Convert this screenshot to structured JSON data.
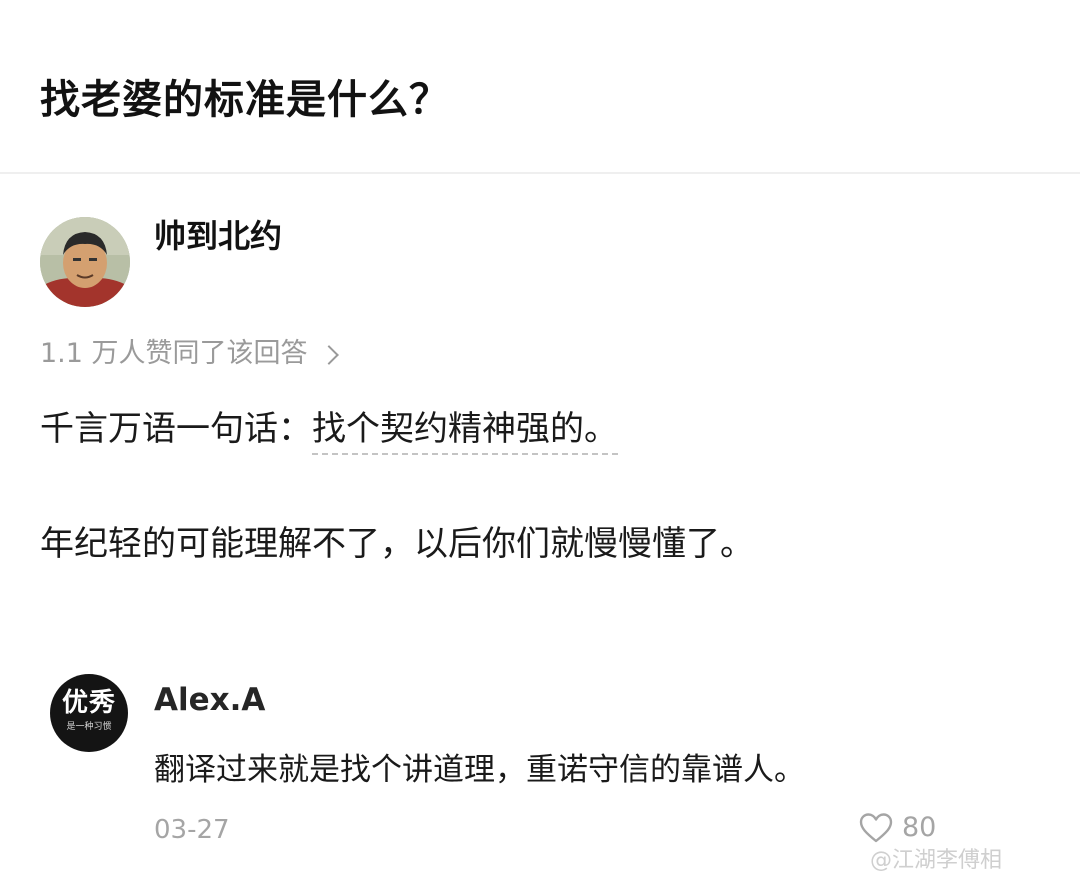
{
  "question": {
    "title": "找老婆的标准是什么？"
  },
  "answer": {
    "author": {
      "name": "帅到北约",
      "avatar": "avatar-icon"
    },
    "votes_text": "1.1 万人赞同了该回答",
    "paragraph1_prefix": "千言万语一句话：",
    "paragraph1_underlined": "找个契约精神强的。",
    "paragraph2": "年纪轻的可能理解不了，以后你们就慢慢懂了。"
  },
  "comment": {
    "avatar_text": "优秀",
    "avatar_subtext": "是一种习惯",
    "username": "Alex.A",
    "text": "翻译过来就是找个讲道理，重诺守信的靠谱人。",
    "date": "03-27",
    "likes": "80"
  },
  "watermark": "@江湖李傅相",
  "colors": {
    "title": "#121212",
    "meta_gray": "#9a9a9a",
    "divider": "#efefef",
    "comment_avatar_bg": "#141414"
  }
}
